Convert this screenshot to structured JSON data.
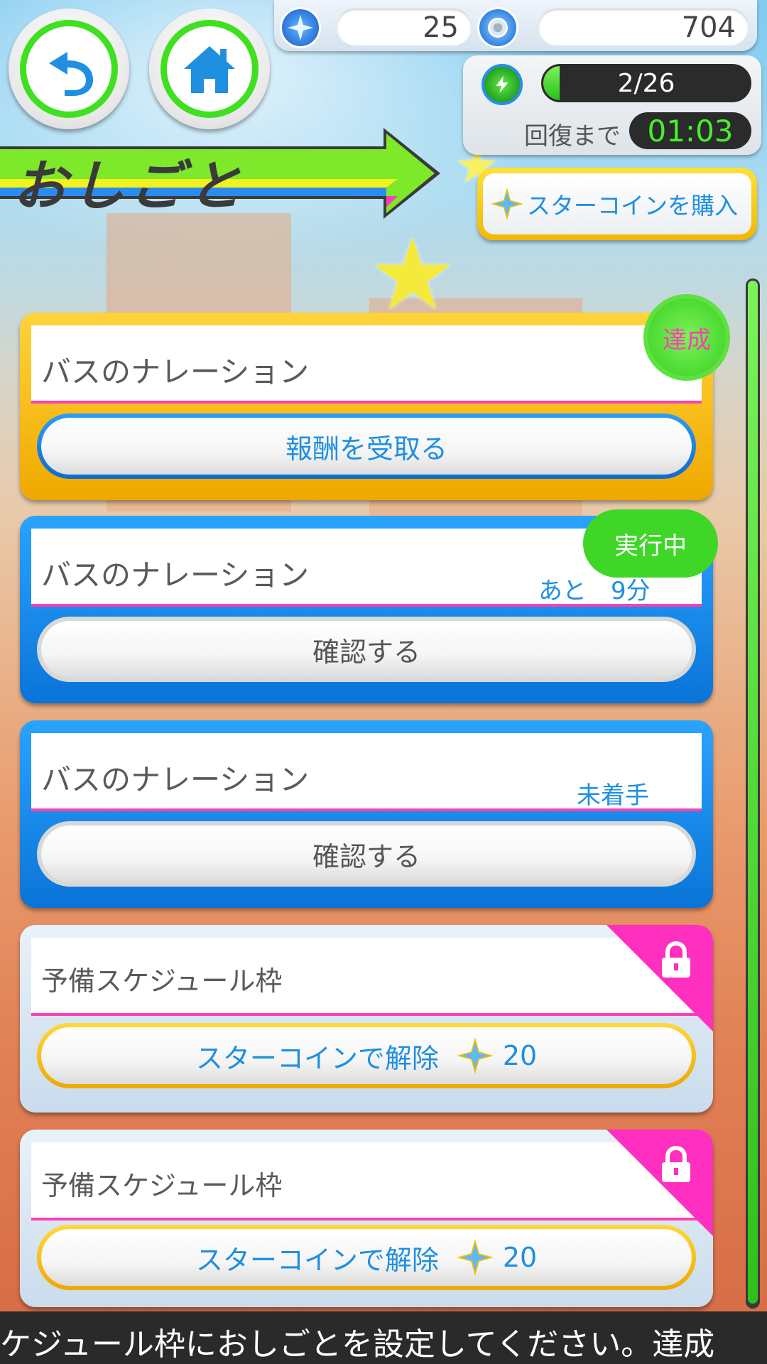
{
  "header": {
    "back_icon": "back-arrow-icon",
    "home_icon": "home-icon",
    "title": "おしごと"
  },
  "currency": {
    "star_coins": "25",
    "coins": "704"
  },
  "stamina": {
    "value_text": "2/26",
    "fill_fraction": 0.077,
    "recover_label": "回復まで",
    "timer": "01:03"
  },
  "buy_button": {
    "label": "スターコインを購入"
  },
  "cards": [
    {
      "name": "バスのナレーション",
      "badge": "達成",
      "button": "報酬を受取る"
    },
    {
      "name": "バスのナレーション",
      "badge": "実行中",
      "note": "あと　9分",
      "button": "確認する"
    },
    {
      "name": "バスのナレーション",
      "note": "未着手",
      "button": "確認する"
    },
    {
      "name": "予備スケジュール枠",
      "button": "スターコインで解除",
      "cost": "20"
    },
    {
      "name": "予備スケジュール枠",
      "button": "スターコインで解除",
      "cost": "20"
    }
  ],
  "ticker": "ケジュール枠におしごとを設定してください。達成",
  "colors": {
    "accent_green": "#3fe01f",
    "accent_blue": "#1f8fe0",
    "accent_pink": "#ff3fb5",
    "accent_gold": "#f0a800"
  }
}
